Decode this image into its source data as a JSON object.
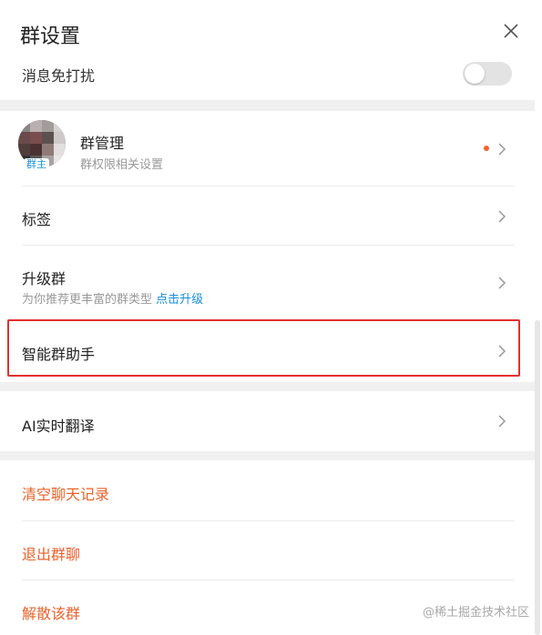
{
  "header": {
    "title": "群设置"
  },
  "mute": {
    "label": "消息免打扰"
  },
  "group_manage": {
    "avatar_badge": "群主",
    "title": "群管理",
    "subtitle": "群权限相关设置"
  },
  "tags": {
    "label": "标签"
  },
  "upgrade": {
    "label": "升级群",
    "subtitle": "为你推荐更丰富的群类型",
    "link": "点击升级"
  },
  "assistant": {
    "label": "智能群助手"
  },
  "translate": {
    "label": "AI实时翻译"
  },
  "danger": {
    "clear_history": "清空聊天记录",
    "quit_group": "退出群聊",
    "dissolve_group": "解散该群"
  },
  "watermark": "@稀土掘金技术社区",
  "colors": {
    "accent_red": "#e8622a",
    "link_blue": "#1a8fd8",
    "highlight": "#e0312f",
    "dot": "#f5642a"
  }
}
